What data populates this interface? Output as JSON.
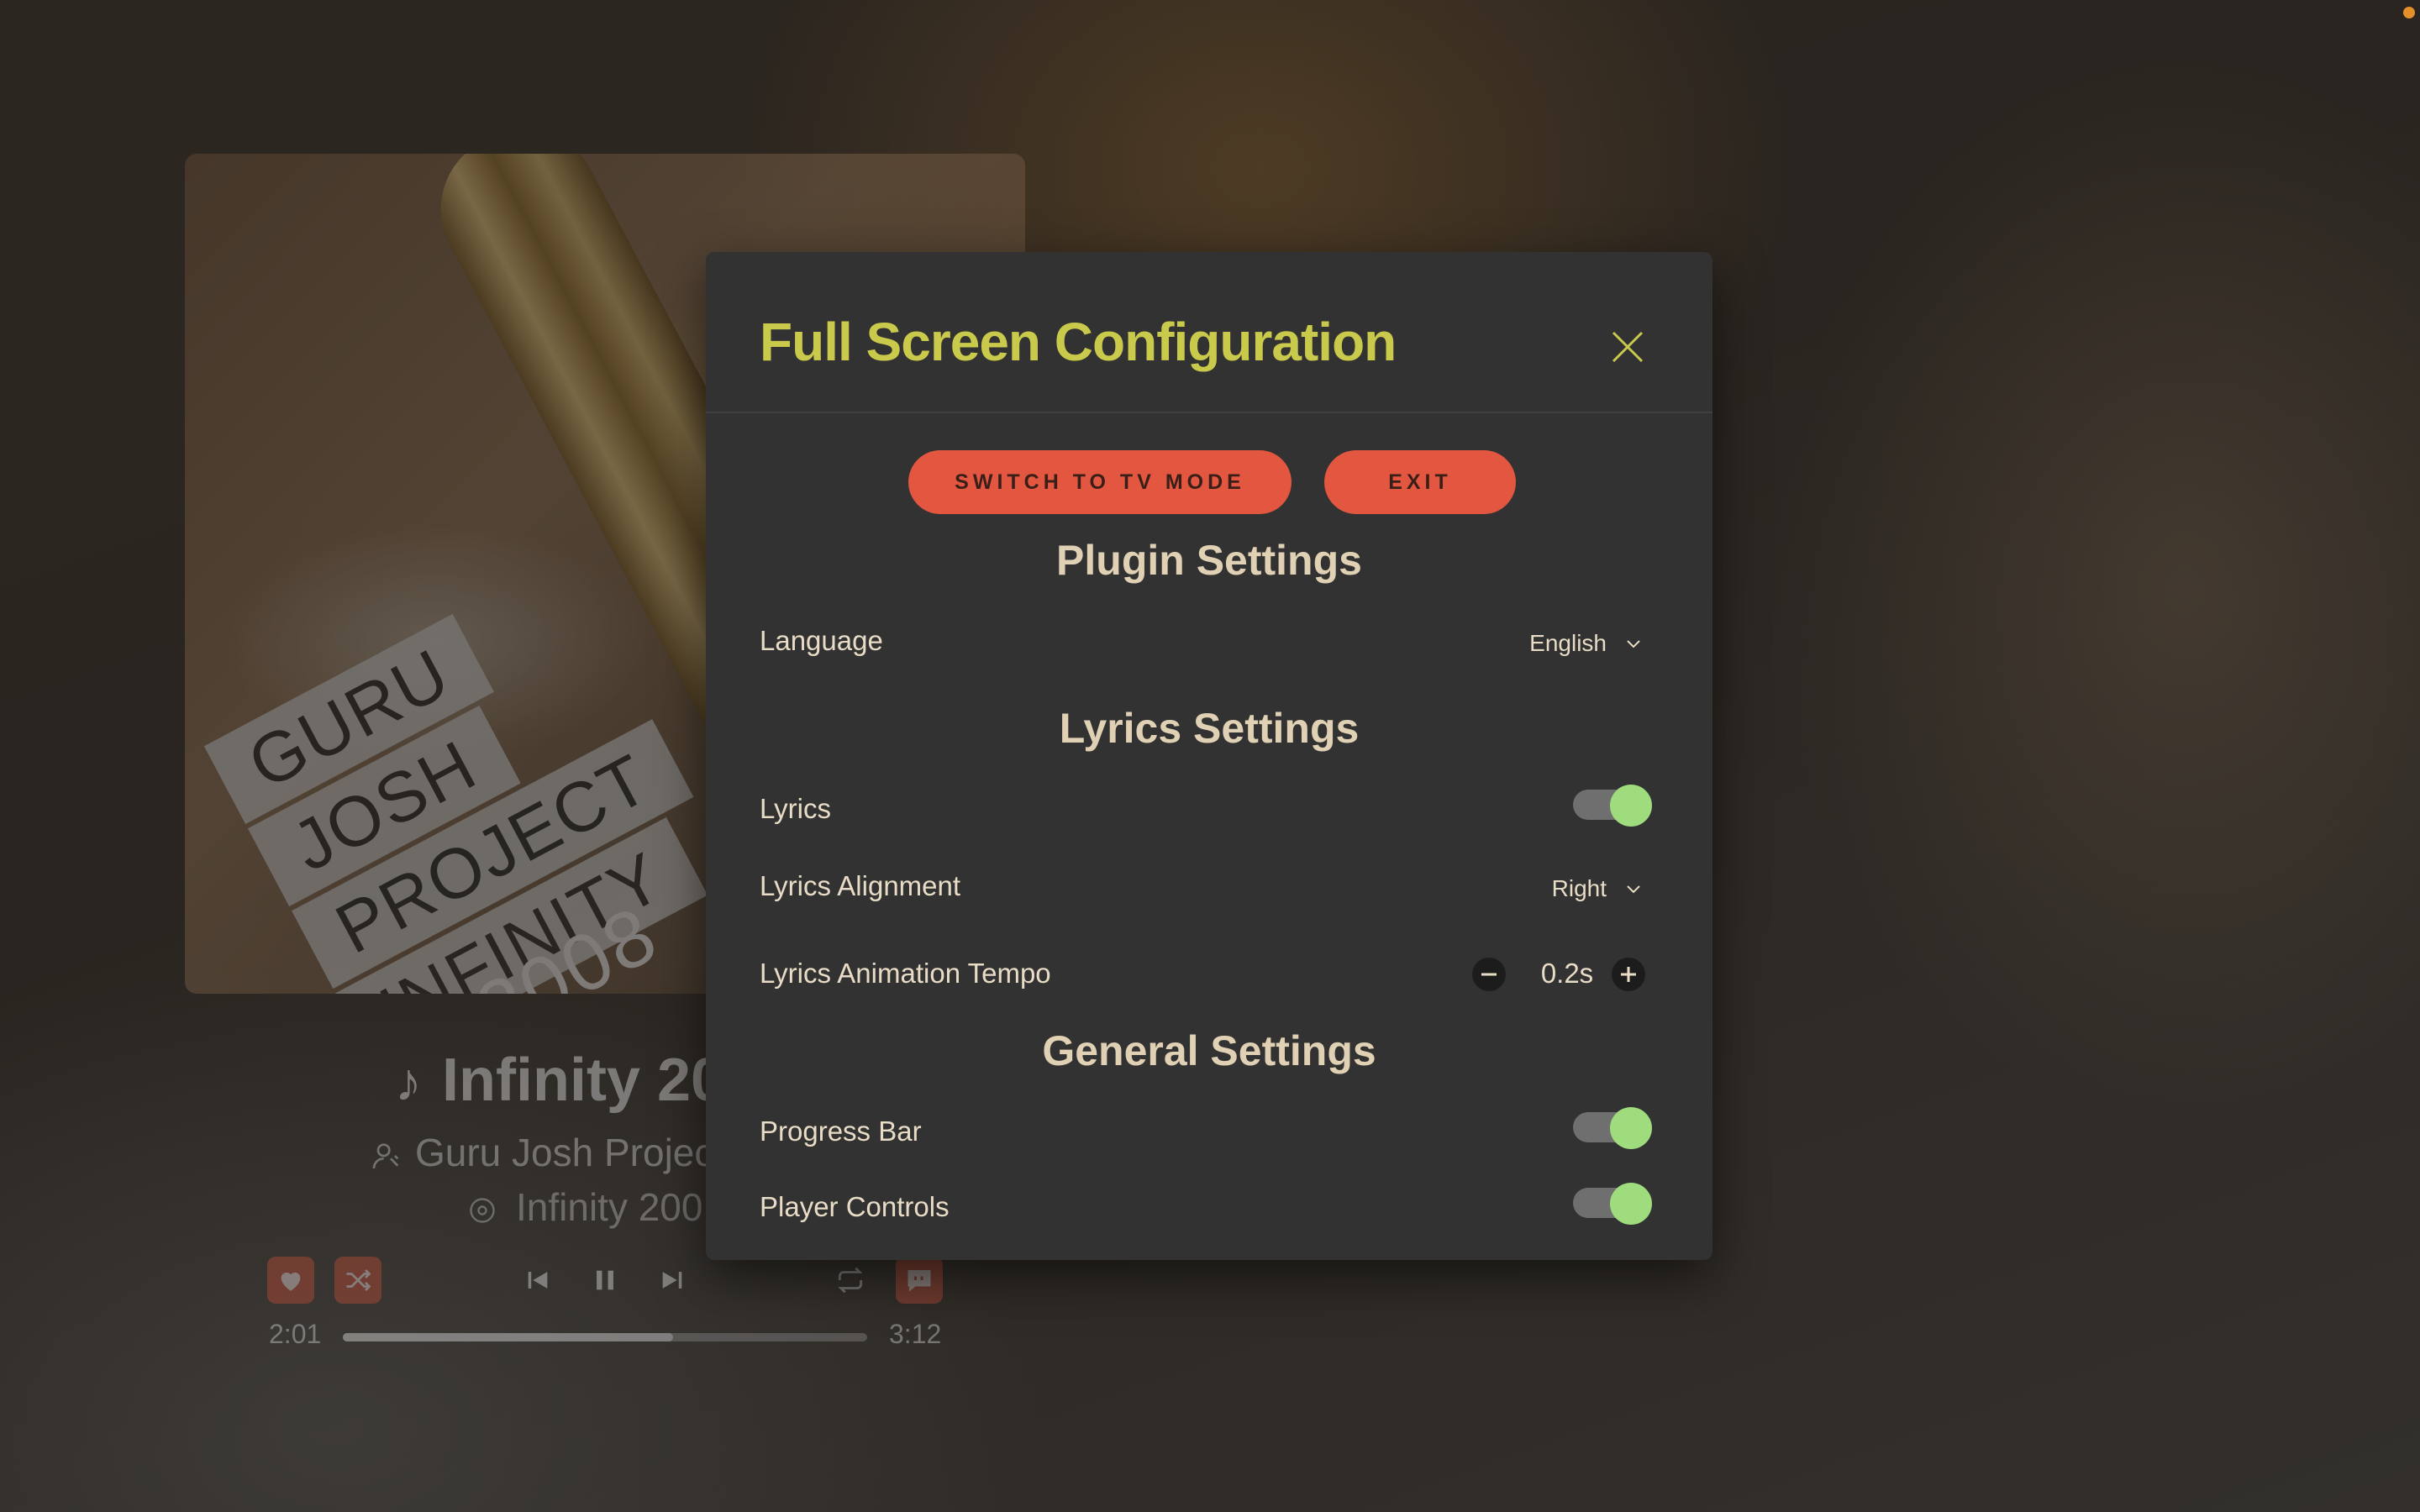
{
  "player": {
    "album_art_text": [
      "GURU",
      "JOSH",
      "PROJECT",
      "INFINITY"
    ],
    "album_art_year": "2008",
    "track_title": "Infinity 20",
    "artist": "Guru Josh Projec",
    "album": "Infinity 200",
    "elapsed": "2:01",
    "duration": "3:12",
    "progress": 0.63
  },
  "modal": {
    "title": "Full Screen Configuration",
    "buttons": {
      "tv_mode": "SWITCH TO TV MODE",
      "exit": "EXIT"
    },
    "plugin_settings": {
      "heading": "Plugin Settings",
      "language_label": "Language",
      "language_value": "English"
    },
    "lyrics_settings": {
      "heading": "Lyrics Settings",
      "lyrics_label": "Lyrics",
      "lyrics_enabled": true,
      "alignment_label": "Lyrics Alignment",
      "alignment_value": "Right",
      "tempo_label": "Lyrics Animation Tempo",
      "tempo_value": "0.2s"
    },
    "general_settings": {
      "heading": "General Settings",
      "progress_bar_label": "Progress Bar",
      "progress_bar_enabled": true,
      "player_controls_label": "Player Controls",
      "player_controls_enabled": true
    }
  },
  "colors": {
    "title": "#c9c94c",
    "button": "#e35640",
    "toggle_on": "#9fdc7e",
    "modal_bg": "#323232"
  }
}
